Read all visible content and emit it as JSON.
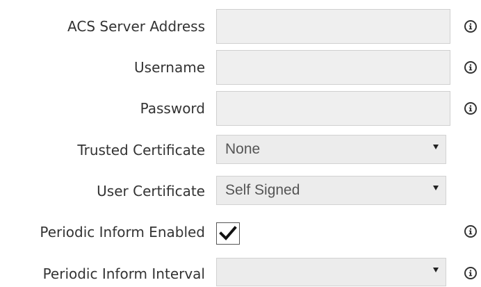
{
  "form": {
    "acs_server_address": {
      "label": "ACS Server Address",
      "value": ""
    },
    "username": {
      "label": "Username",
      "value": ""
    },
    "password": {
      "label": "Password",
      "value": ""
    },
    "trusted_certificate": {
      "label": "Trusted Certificate",
      "selected": "None"
    },
    "user_certificate": {
      "label": "User Certificate",
      "selected": "Self Signed"
    },
    "periodic_inform_enabled": {
      "label": "Periodic Inform Enabled",
      "checked": true
    },
    "periodic_inform_interval": {
      "label": "Periodic Inform Interval",
      "selected": ""
    }
  },
  "icons": {
    "info": "info-icon",
    "caret": "chevron-down-icon",
    "check": "checkmark-icon"
  },
  "colors": {
    "text": "#333333",
    "field_background": "#efefef",
    "field_border": "#cfcfcf"
  }
}
